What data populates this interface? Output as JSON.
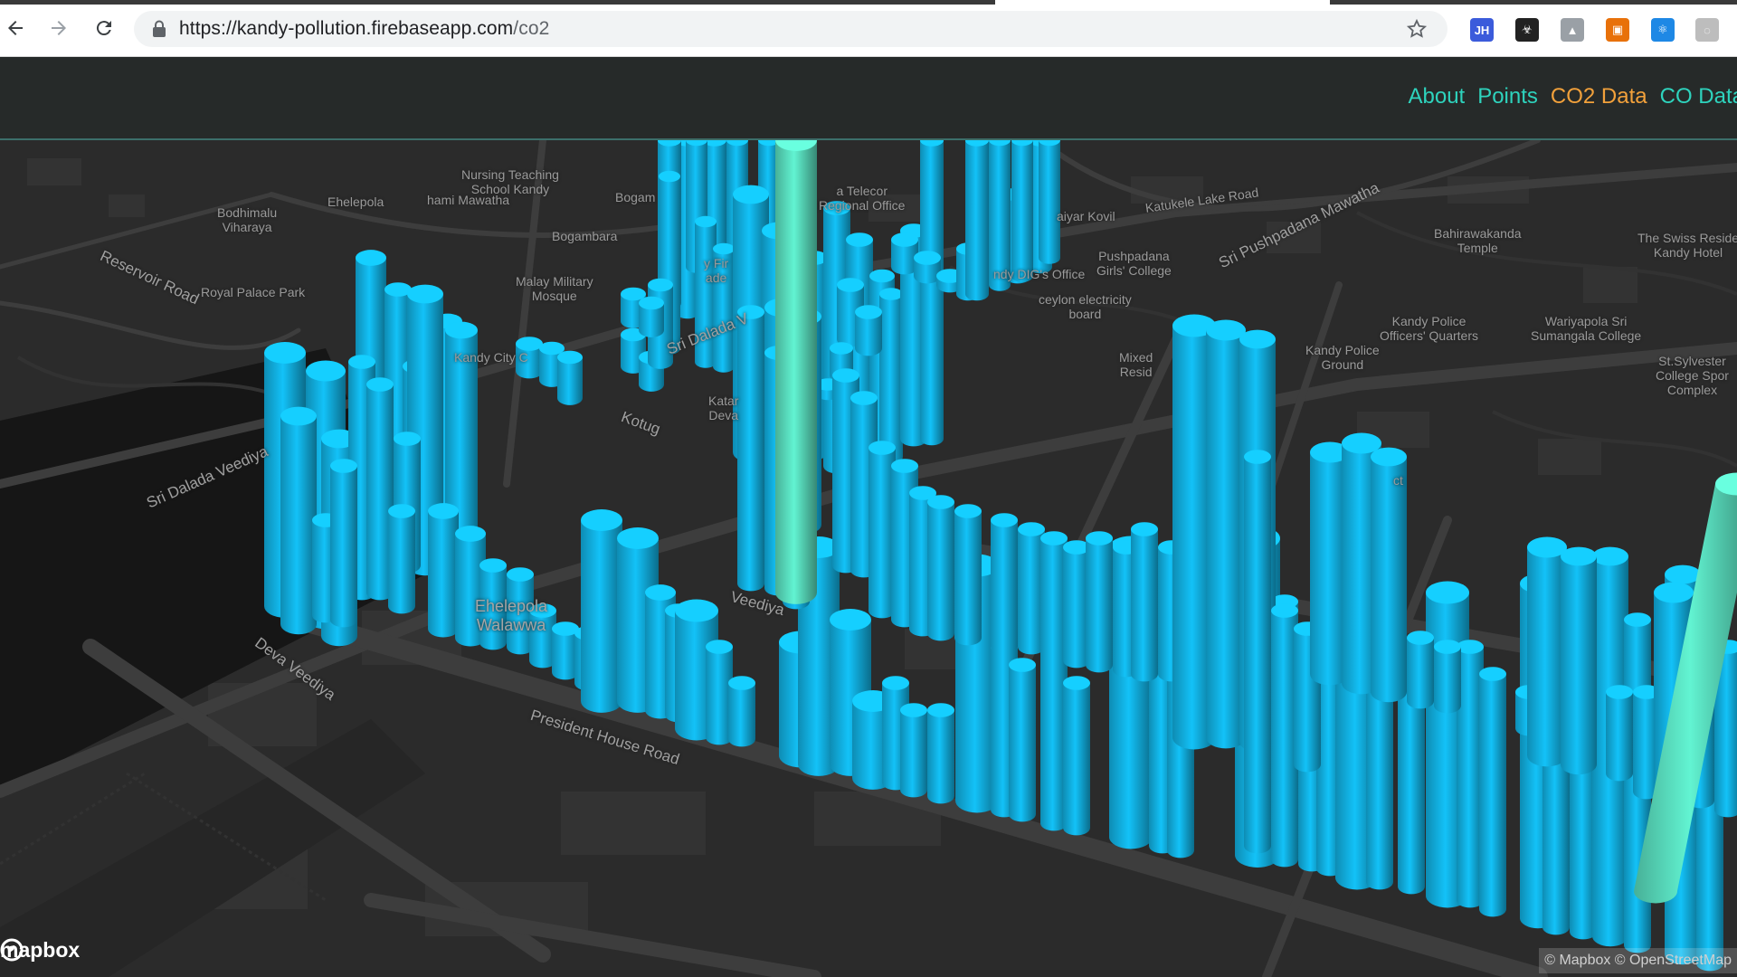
{
  "browser": {
    "url_host": "https://kandy-pollution.firebaseapp.com",
    "url_path": "/co2",
    "extensions": [
      {
        "name": "jh-extension-icon",
        "label": "JH",
        "color": "#3b5bdb"
      },
      {
        "name": "biohazard-extension-icon",
        "label": "☣",
        "color": "#222222"
      },
      {
        "name": "drive-extension-icon",
        "label": "▲",
        "color": "#9aa0a6"
      },
      {
        "name": "image-extension-icon",
        "label": "▣",
        "color": "#e8710a"
      },
      {
        "name": "react-extension-icon",
        "label": "⚛",
        "color": "#1e88e5"
      },
      {
        "name": "profile-extension-icon",
        "label": "◌",
        "color": "#bdbdbd"
      }
    ]
  },
  "nav": {
    "about": "About",
    "points": "Points",
    "co2": "CO2 Data",
    "co": "CO Data"
  },
  "colors": {
    "accent_link": "#2ed3bd",
    "active_link": "#f2a13b",
    "bar_blue": "#12b4e6",
    "bar_green": "#5be2c2"
  },
  "map": {
    "labels": [
      {
        "name": "label-nursing-teaching",
        "text": "Nursing Teaching\nSchool Kandy"
      },
      {
        "name": "label-bodhimalu",
        "text": "Bodhimalu\nViharaya"
      },
      {
        "name": "label-ehelepola",
        "text": "Ehelepola"
      },
      {
        "name": "label-hami-mawatha",
        "text": "hami Mawatha"
      },
      {
        "name": "label-bogam",
        "text": "Bogam"
      },
      {
        "name": "label-telecom",
        "text": "a Telecor\nRegional Office"
      },
      {
        "name": "label-katukele",
        "text": "Katukele Lake Road"
      },
      {
        "name": "label-reservoir-road",
        "text": "Reservoir Road"
      },
      {
        "name": "label-bogambara",
        "text": "Bogambara"
      },
      {
        "name": "label-kovil",
        "text": "aiyar Kovil"
      },
      {
        "name": "label-pushpadana-mawatha",
        "text": "Sri Pushpadana Mawatha"
      },
      {
        "name": "label-bahirawakanda",
        "text": "Bahirawakanda\nTemple"
      },
      {
        "name": "label-swiss",
        "text": "The Swiss Reside\nKandy Hotel"
      },
      {
        "name": "label-pushpadana-college",
        "text": "Pushpadana\nGirls' College"
      },
      {
        "name": "label-royal-palace-park",
        "text": "Royal Palace Park"
      },
      {
        "name": "label-malay-mosque",
        "text": "Malay Military\nMosque"
      },
      {
        "name": "label-dig-office",
        "text": "ndy DIG's Office"
      },
      {
        "name": "label-ceylon-electricity",
        "text": "ceylon electricity\nboard"
      },
      {
        "name": "label-police-quarters",
        "text": "Kandy Police\nOfficers' Quarters"
      },
      {
        "name": "label-wariyapola",
        "text": "Wariyapola Sri\nSumangala College"
      },
      {
        "name": "label-kandy-city",
        "text": "Kandy City C"
      },
      {
        "name": "label-sri-dalada",
        "text": "Sri Dalada V"
      },
      {
        "name": "label-mixed",
        "text": "Mixed\nResid"
      },
      {
        "name": "label-kandy-police",
        "text": "Kandy Police\nGround"
      },
      {
        "name": "label-sylvester",
        "text": "St.Sylvester\nCollege Spor\nComplex"
      },
      {
        "name": "label-katar",
        "text": "Katar\nDeva"
      },
      {
        "name": "label-kotug",
        "text": "Kotug"
      },
      {
        "name": "label-sri-dalada-veediya",
        "text": "Sri Dalada Veediya"
      },
      {
        "name": "label-ehelepola-walawwa",
        "text": "Ehelepola\nWalawwa"
      },
      {
        "name": "label-deva-veediya",
        "text": "Deva Veediya"
      },
      {
        "name": "label-veediya",
        "text": "Veediya"
      },
      {
        "name": "label-president-house",
        "text": "President House Road"
      },
      {
        "name": "label-fire-brigade",
        "text": "y Fir\nade"
      },
      {
        "name": "label-ct",
        "text": "ct"
      }
    ],
    "logo": "mapbox",
    "attribution": "© Mapbox © OpenStreetMap"
  }
}
